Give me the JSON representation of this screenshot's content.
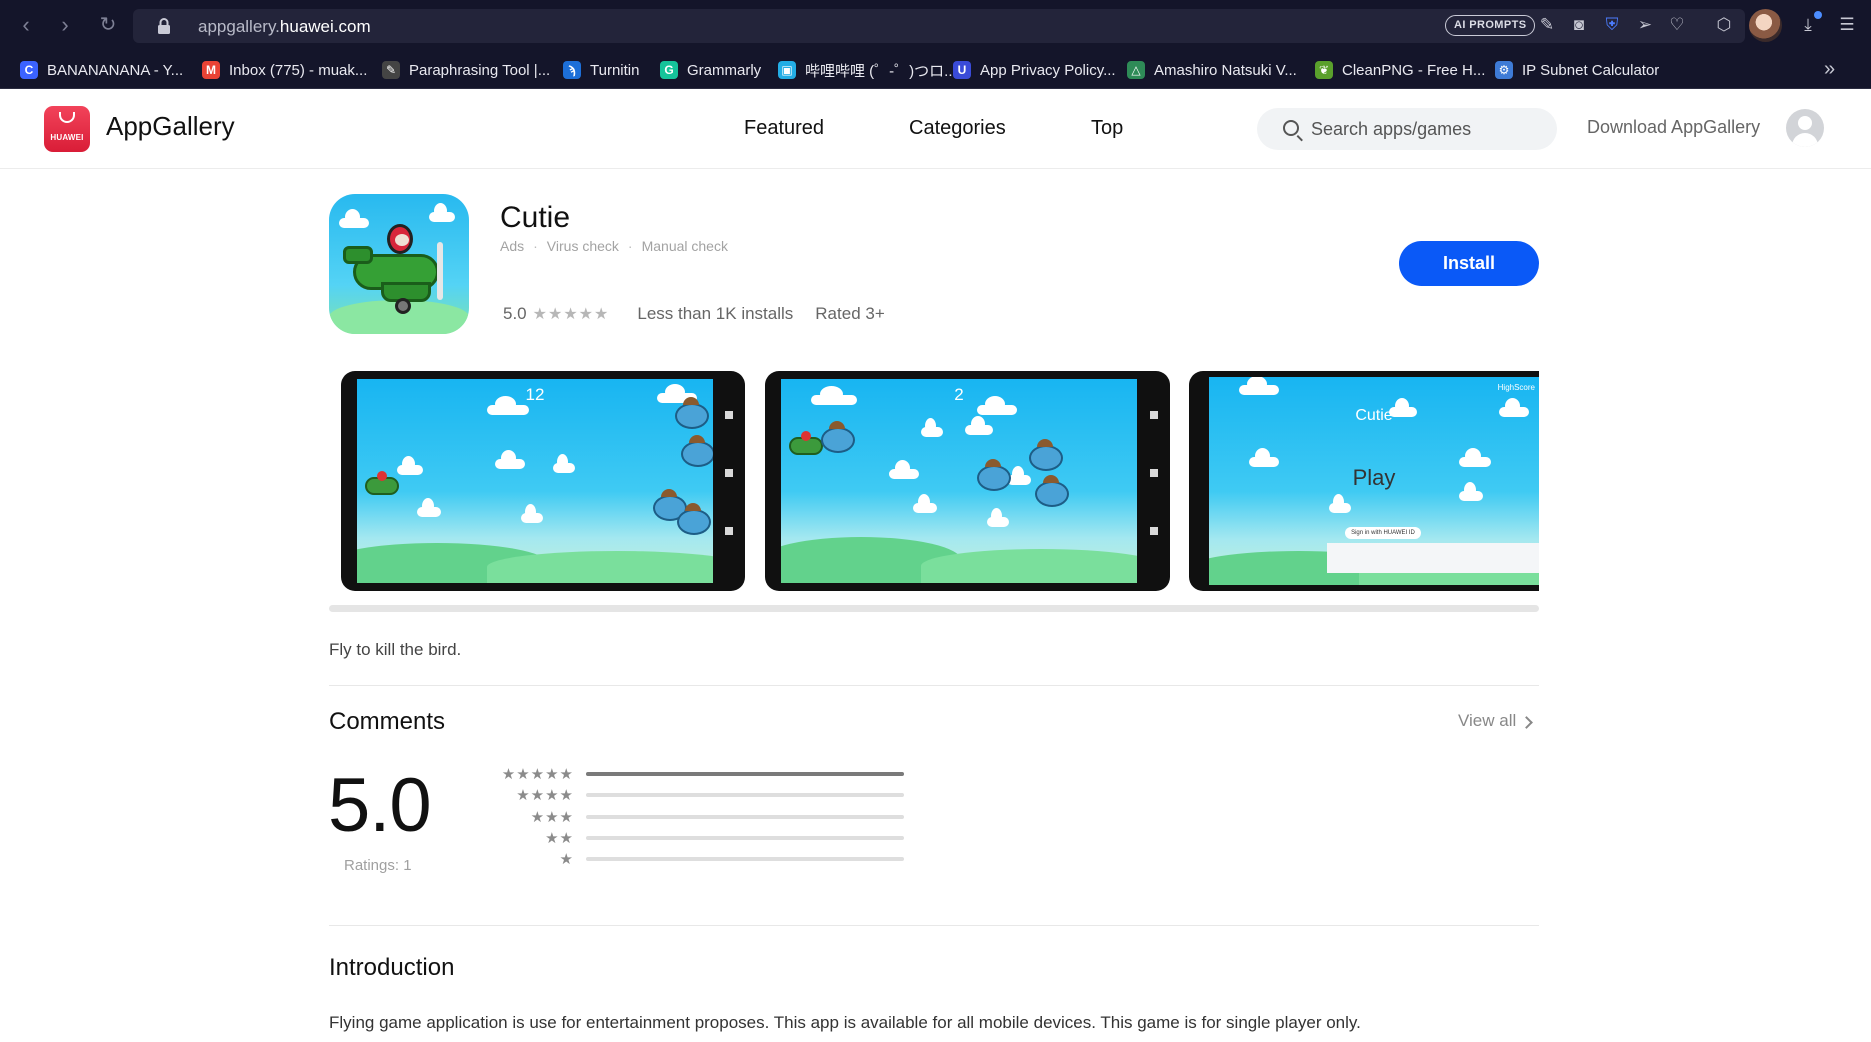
{
  "browser": {
    "url_prefix": "appgallery.",
    "url_domain": "huawei.com",
    "ai_prompts_label": "AI PROMPTS",
    "icons": [
      "back-icon",
      "forward-icon",
      "reload-icon",
      "lock-icon",
      "edit-icon",
      "camera-icon",
      "shield-icon",
      "send-icon",
      "heart-icon",
      "cube-icon",
      "download-icon",
      "menu-icon"
    ],
    "bookmarks": [
      {
        "label": "BANANANANA - Y...",
        "color": "#3b63ff",
        "glyph": "C"
      },
      {
        "label": "Inbox (775) - muak...",
        "color": "#ea4335",
        "glyph": "M"
      },
      {
        "label": "Paraphrasing Tool |...",
        "color": "#444",
        "glyph": "✎"
      },
      {
        "label": "Turnitin",
        "color": "#1d6fd8",
        "glyph": "ϡ"
      },
      {
        "label": "Grammarly",
        "color": "#15c39a",
        "glyph": "G"
      },
      {
        "label": "哔哩哔哩 (゜-゜)つロ...",
        "color": "#23ade5",
        "glyph": "▣"
      },
      {
        "label": "App Privacy Policy...",
        "color": "#3a4bd8",
        "glyph": "U"
      },
      {
        "label": "Amashiro Natsuki V...",
        "color": "#2e8b57",
        "glyph": "△"
      },
      {
        "label": "CleanPNG - Free H...",
        "color": "#5aa02c",
        "glyph": "❦"
      },
      {
        "label": "IP Subnet Calculator",
        "color": "#3e7bd6",
        "glyph": "⚙"
      }
    ]
  },
  "header": {
    "logo_text": "HUAWEI",
    "brand": "AppGallery",
    "nav": [
      "Featured",
      "Categories",
      "Top"
    ],
    "search_placeholder": "Search apps/games",
    "download_label": "Download AppGallery"
  },
  "app": {
    "name": "Cutie",
    "tags": [
      "Ads",
      "Virus check",
      "Manual check"
    ],
    "rating": "5.0",
    "stars": "★★★★★",
    "installs": "Less than 1K installs",
    "age_rating": "Rated 3+",
    "install_label": "Install",
    "description": "Fly to kill the bird."
  },
  "screenshots": [
    {
      "score": "12"
    },
    {
      "score": "2"
    },
    {
      "title": "Cutie",
      "play": "Play",
      "signin": "Sign in with HUAWEI ID",
      "highscore": "HighScore"
    }
  ],
  "comments": {
    "title": "Comments",
    "view_all": "View all",
    "average": "5.0",
    "ratings_label": "Ratings: 1",
    "distribution": [
      {
        "stars": "★★★★★",
        "fraction": 1.0
      },
      {
        "stars": "★★★★",
        "fraction": 0
      },
      {
        "stars": "★★★",
        "fraction": 0
      },
      {
        "stars": "★★",
        "fraction": 0
      },
      {
        "stars": "★",
        "fraction": 0
      }
    ]
  },
  "introduction": {
    "title": "Introduction",
    "text": "Flying game application is use for entertainment proposes. This app is available for all mobile devices. This game is for single player only."
  }
}
